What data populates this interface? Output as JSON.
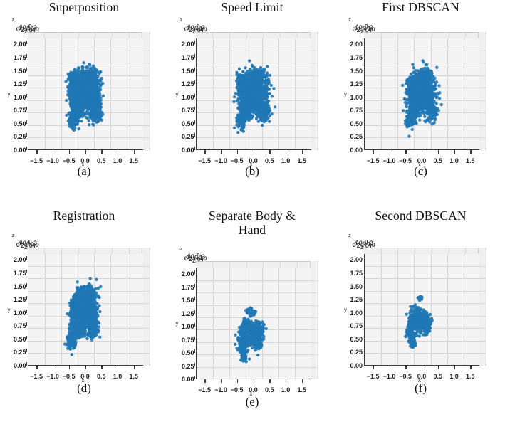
{
  "figure": {
    "axis_labels": {
      "x": "x",
      "y": "y",
      "z": "z"
    },
    "xticks": [
      "−1.5",
      "−1.0",
      "−0.5",
      "0.0",
      "0.5",
      "1.0",
      "1.5"
    ],
    "yticks": [
      "0.00",
      "0.25",
      "0.50",
      "0.75",
      "1.00",
      "1.25",
      "1.50",
      "1.75",
      "2.00"
    ],
    "zticks_overlapped": [
      "0",
      "1",
      "2"
    ],
    "colors": {
      "marker": "#2077b4",
      "pane": "#f4f4f4",
      "pane_side": "#efefef",
      "grid": "#d6d6d6",
      "axis": "#3a3a3a",
      "text": "#111111",
      "background": "#ffffff"
    },
    "panels": [
      {
        "title": "Superposition",
        "caption": "(a)"
      },
      {
        "title": "Speed Limit",
        "caption": "(b)"
      },
      {
        "title": "First DBSCAN",
        "caption": "(c)"
      },
      {
        "title": "Registration",
        "caption": "(d)"
      },
      {
        "title": "Separate Body &\nHand",
        "caption": "(e)"
      },
      {
        "title": "Second DBSCAN",
        "caption": "(f)"
      }
    ]
  },
  "chart_data": [
    {
      "type": "scatter",
      "title": "Superposition",
      "xlabel": "x",
      "ylabel": "y",
      "zlabel": "z",
      "xlim": [
        -1.75,
        1.75
      ],
      "ylim": [
        0.0,
        2.1
      ],
      "xticks": [
        -1.5,
        -1.0,
        -0.5,
        0.0,
        0.5,
        1.0,
        1.5
      ],
      "yticks": [
        0.0,
        0.25,
        0.5,
        0.75,
        1.0,
        1.25,
        1.5,
        1.75,
        2.0
      ],
      "grid": true,
      "legend": "none",
      "projection": "3d",
      "point_color": "#2077b4",
      "n_points_approx": 2600,
      "cluster_bbox": {
        "xmin": -0.62,
        "xmax": 0.52,
        "ymin": 0.42,
        "ymax": 1.52
      },
      "description": "Dense merged humanoid point cloud, widest of all panels; body trunk plus two leg-like lobes below y=0.80 and head region near y=1.45."
    },
    {
      "type": "scatter",
      "title": "Speed Limit",
      "xlabel": "x",
      "ylabel": "y",
      "zlabel": "z",
      "xlim": [
        -1.75,
        1.75
      ],
      "ylim": [
        0.0,
        2.1
      ],
      "xticks": [
        -1.5,
        -1.0,
        -0.5,
        0.0,
        0.5,
        1.0,
        1.5
      ],
      "yticks": [
        0.0,
        0.25,
        0.5,
        0.75,
        1.0,
        1.25,
        1.5,
        1.75,
        2.0
      ],
      "grid": true,
      "legend": "none",
      "projection": "3d",
      "point_color": "#2077b4",
      "n_points_approx": 2400,
      "cluster_bbox": {
        "xmin": -0.6,
        "xmax": 0.5,
        "ymin": 0.44,
        "ymax": 1.52
      },
      "description": "Nearly identical to (a) after speed filtering; slightly fewer stray points at the periphery."
    },
    {
      "type": "scatter",
      "title": "First DBSCAN",
      "xlabel": "x",
      "ylabel": "y",
      "zlabel": "z",
      "xlim": [
        -1.75,
        1.75
      ],
      "ylim": [
        0.0,
        2.1
      ],
      "xticks": [
        -1.5,
        -1.0,
        -0.5,
        0.0,
        0.5,
        1.0,
        1.5
      ],
      "yticks": [
        0.0,
        0.25,
        0.5,
        0.75,
        1.0,
        1.25,
        1.5,
        1.75,
        2.0
      ],
      "grid": true,
      "legend": "none",
      "projection": "3d",
      "point_color": "#2077b4",
      "n_points_approx": 2100,
      "cluster_bbox": {
        "xmin": -0.55,
        "xmax": 0.48,
        "ymin": 0.46,
        "ymax": 1.5
      },
      "description": "Outliers removed by density clustering; single compact humanoid blob remains."
    },
    {
      "type": "scatter",
      "title": "Registration",
      "xlabel": "x",
      "ylabel": "y",
      "zlabel": "z",
      "xlim": [
        -1.75,
        1.75
      ],
      "ylim": [
        0.0,
        2.1
      ],
      "xticks": [
        -1.5,
        -1.0,
        -0.5,
        0.0,
        0.5,
        1.0,
        1.5
      ],
      "yticks": [
        0.0,
        0.25,
        0.5,
        0.75,
        1.0,
        1.25,
        1.5,
        1.75,
        2.0
      ],
      "grid": true,
      "legend": "none",
      "projection": "3d",
      "point_color": "#2077b4",
      "n_points_approx": 2000,
      "cluster_bbox": {
        "xmin": -0.58,
        "xmax": 0.38,
        "ymin": 0.3,
        "ymax": 1.46
      },
      "description": "Aligned cloud, narrower in x and extending lower in y to about 0.30 with an elongated lower-left limb."
    },
    {
      "type": "scatter",
      "title": "Separate Body & Hand",
      "xlabel": "x",
      "ylabel": "y",
      "zlabel": "z",
      "xlim": [
        -1.75,
        1.75
      ],
      "ylim": [
        0.0,
        2.1
      ],
      "xticks": [
        -1.5,
        -1.0,
        -0.5,
        0.0,
        0.5,
        1.0,
        1.5
      ],
      "yticks": [
        0.0,
        0.25,
        0.5,
        0.75,
        1.0,
        1.25,
        1.5,
        1.75,
        2.0
      ],
      "grid": true,
      "legend": "none",
      "projection": "3d",
      "point_color": "#2077b4",
      "n_points_approx": 1100,
      "cluster_bbox": {
        "xmin": -0.55,
        "xmax": 0.3,
        "ymin": 0.33,
        "ymax": 1.32
      },
      "description": "Sparser cloud; a small detached hand cluster sits near x=-0.15,y=1.28 above the main body mass centered near y=0.80."
    },
    {
      "type": "scatter",
      "title": "Second DBSCAN",
      "xlabel": "x",
      "ylabel": "y",
      "zlabel": "z",
      "xlim": [
        -1.75,
        1.75
      ],
      "ylim": [
        0.0,
        2.1
      ],
      "xticks": [
        -1.5,
        -1.0,
        -0.5,
        0.0,
        0.5,
        1.0,
        1.5
      ],
      "yticks": [
        0.0,
        0.25,
        0.5,
        0.75,
        1.0,
        1.25,
        1.5,
        1.75,
        2.0
      ],
      "grid": true,
      "legend": "none",
      "projection": "3d",
      "point_color": "#2077b4",
      "n_points_approx": 900,
      "cluster_bbox": {
        "xmin": -0.52,
        "xmax": 0.28,
        "ymin": 0.35,
        "ymax": 1.3
      },
      "description": "Final refined cloud; isolated small hand blob near x=-0.05,y=1.28 plus compact torso and leg cluster between y=0.40 and y=1.05."
    }
  ]
}
